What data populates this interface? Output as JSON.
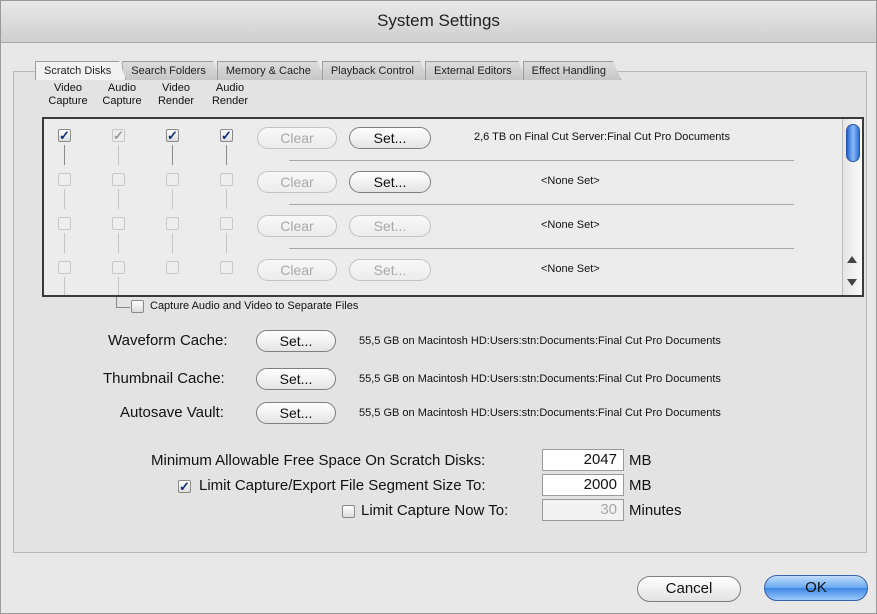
{
  "window": {
    "title": "System Settings"
  },
  "tabs": [
    {
      "label": "Scratch Disks"
    },
    {
      "label": "Search Folders"
    },
    {
      "label": "Memory & Cache"
    },
    {
      "label": "Playback Control"
    },
    {
      "label": "External Editors"
    },
    {
      "label": "Effect Handling"
    }
  ],
  "columns": [
    {
      "line1": "Video",
      "line2": "Capture"
    },
    {
      "line1": "Audio",
      "line2": "Capture"
    },
    {
      "line1": "Video",
      "line2": "Render"
    },
    {
      "line1": "Audio",
      "line2": "Render"
    }
  ],
  "scratch_rows": [
    {
      "checks": [
        "✓",
        "✓",
        "✓",
        "✓"
      ],
      "clear_label": "Clear",
      "set_label": "Set...",
      "path": "2,6 TB on  Final Cut Server:Final Cut Pro Documents"
    },
    {
      "checks": [
        "",
        "",
        "",
        ""
      ],
      "clear_label": "Clear",
      "set_label": "Set...",
      "path": "<None Set>"
    },
    {
      "checks": [
        "",
        "",
        "",
        ""
      ],
      "clear_label": "Clear",
      "set_label": "Set...",
      "path": "<None Set>"
    },
    {
      "checks": [
        "",
        "",
        "",
        ""
      ],
      "clear_label": "Clear",
      "set_label": "Set...",
      "path": "<None Set>"
    }
  ],
  "separate_files": {
    "label": "Capture Audio and Video to Separate Files",
    "checked": false
  },
  "caches": [
    {
      "label": "Waveform Cache:",
      "button": "Set...",
      "path": "55,5 GB on  Macintosh HD:Users:stn:Documents:Final Cut Pro Documents"
    },
    {
      "label": "Thumbnail Cache:",
      "button": "Set...",
      "path": "55,5 GB on  Macintosh HD:Users:stn:Documents:Final Cut Pro Documents"
    },
    {
      "label": "Autosave Vault:",
      "button": "Set...",
      "path": "55,5 GB on  Macintosh HD:Users:stn:Documents:Final Cut Pro Documents"
    }
  ],
  "limits": {
    "min_free_label": "Minimum Allowable Free Space On Scratch Disks:",
    "min_free_value": "2047",
    "min_free_unit": "MB",
    "segment_label": "Limit Capture/Export File Segment Size To:",
    "segment_checked": true,
    "segment_value": "2000",
    "segment_unit": "MB",
    "capture_now_label": "Limit Capture Now To:",
    "capture_now_checked": false,
    "capture_now_value": "30",
    "capture_now_unit": "Minutes"
  },
  "buttons": {
    "cancel": "Cancel",
    "ok": "OK"
  },
  "colors": {
    "accent": "#3b86e5",
    "check": "#0c2f7a"
  }
}
